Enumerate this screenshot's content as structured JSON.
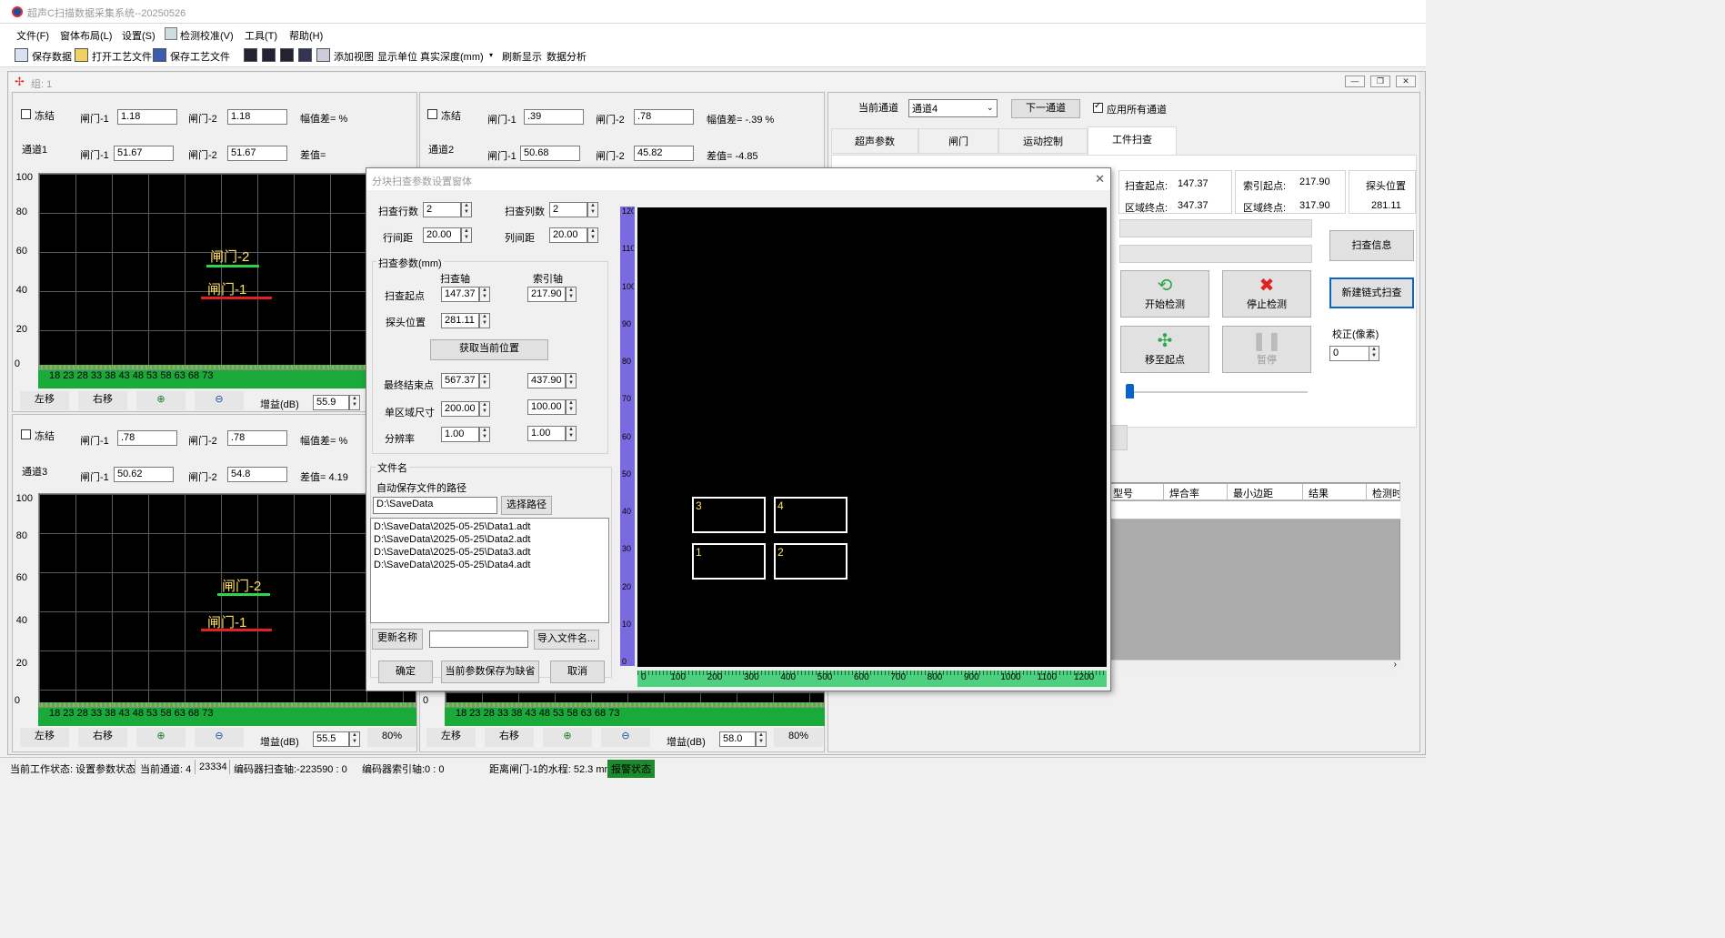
{
  "window": {
    "title": "超声C扫描数据采集系统--20250526"
  },
  "menu": [
    "文件(F)",
    "窗体布局(L)",
    "设置(S)",
    "检测校准(V)",
    "工具(T)",
    "帮助(H)"
  ],
  "toolbar": {
    "save_data": "保存数据",
    "open_process": "打开工艺文件",
    "save_process": "保存工艺文件",
    "add_view": "添加视图",
    "show_unit": "显示单位",
    "depth_mode": "真实深度(mm)",
    "refresh": "刷新显示",
    "analysis": "数据分析"
  },
  "mdi": {
    "title": "组: 1"
  },
  "ch1": {
    "freeze": "冻结",
    "name": "通道1",
    "gate1_lbl": "闸门-1",
    "gate2_lbl": "闸门-2",
    "g1a": "1.18",
    "g2a": "1.18",
    "amp_diff": "幅值差=  %",
    "g1b": "51.67",
    "g2b": "51.67",
    "diff": "差值="
  },
  "ch2": {
    "freeze": "冻结",
    "name": "通道2",
    "gate1_lbl": "闸门-1",
    "gate2_lbl": "闸门-2",
    "g1a": ".39",
    "g2a": ".78",
    "amp_diff": "幅值差= -.39 %",
    "g1b": "50.68",
    "g2b": "45.82",
    "diff": "差值= -4.85"
  },
  "ch3": {
    "freeze": "冻结",
    "name": "通道3",
    "gate1_lbl": "闸门-1",
    "gate2_lbl": "闸门-2",
    "g1a": ".78",
    "g2a": ".78",
    "amp_diff": "幅值差=  %",
    "g1b": "50.62",
    "g2b": "54.8",
    "diff": "差值= 4.19"
  },
  "scope": {
    "yticks": [
      "100",
      "80",
      "60",
      "40",
      "20",
      "0"
    ],
    "xticks": "18  23  28  33  38  43  48  53  58  63  68  73",
    "gate1": "闸门-1",
    "gate2": "闸门-2"
  },
  "scopebtns": {
    "left": "左移",
    "right": "右移",
    "gain": "增益(dB)",
    "gain1": "55.9",
    "gain3": "55.5",
    "gain4": "58.0",
    "pct3": "80%",
    "pct4": "80%",
    "zero": "0"
  },
  "right": {
    "cur_ch_lbl": "当前通道",
    "cur_ch": "通道4",
    "next": "下一通道",
    "apply_all": "应用所有通道",
    "tabs": [
      "超声参数",
      "闸门",
      "运动控制",
      "工件扫查"
    ],
    "scan_start_lbl": "扫查起点:",
    "scan_start": "147.37",
    "area_end_lbl": "区域终点:",
    "area_end": "347.37",
    "idx_start_lbl": "索引起点:",
    "idx_start": "217.90",
    "idx_end_lbl": "区域终点:",
    "idx_end": "317.90",
    "probe_pos_lbl": "探头位置",
    "probe_pos": "281.11",
    "scan_info": "扫查信息",
    "new_chain": "新建链式扫查",
    "start": "开始检测",
    "stop": "停止检测",
    "to_origin": "移至起点",
    "pause": "暂停",
    "correct_lbl": "校正(像素)",
    "correct": "0",
    "table_headers": [
      "型号",
      "焊合率",
      "最小边距",
      "结果",
      "检测时"
    ]
  },
  "dialog": {
    "title": "分块扫查参数设置窗体",
    "rows_lbl": "扫查行数",
    "rows": "2",
    "cols_lbl": "扫查列数",
    "cols": "2",
    "row_gap_lbl": "行间距",
    "row_gap": "20.00",
    "col_gap_lbl": "列间距",
    "col_gap": "20.00",
    "params_lbl": "扫查参数(mm)",
    "scan_axis": "扫查轴",
    "index_axis": "索引轴",
    "start_lbl": "扫查起点",
    "start_s": "147.37",
    "start_i": "217.90",
    "probe_lbl": "探头位置",
    "probe": "281.11",
    "get_pos": "获取当前位置",
    "end_lbl": "最终结束点",
    "end_s": "567.37",
    "end_i": "437.90",
    "size_lbl": "单区域尺寸",
    "size_s": "200.00",
    "size_i": "100.00",
    "res_lbl": "分辨率",
    "res_s": "1.00",
    "res_i": "1.00",
    "file_lbl": "文件名",
    "path_lbl": "自动保存文件的路径",
    "path": "D:\\SaveData",
    "choose": "选择路径",
    "files": [
      "D:\\SaveData\\2025-05-25\\Data1.adt",
      "D:\\SaveData\\2025-05-25\\Data2.adt",
      "D:\\SaveData\\2025-05-25\\Data3.adt",
      "D:\\SaveData\\2025-05-25\\Data4.adt"
    ],
    "rename": "更新名称",
    "import": "导入文件名...",
    "ok": "确定",
    "save_default": "当前参数保存为缺省",
    "cancel": "取消",
    "yticks": [
      "120",
      "110",
      "100",
      "90",
      "80",
      "70",
      "60",
      "50",
      "40",
      "30",
      "20",
      "10",
      "0"
    ],
    "xticks": [
      "0",
      "100",
      "200",
      "300",
      "400",
      "500",
      "600",
      "700",
      "800",
      "900",
      "1000",
      "1100",
      "1200"
    ],
    "blocks": [
      "3",
      "4",
      "1",
      "2"
    ]
  },
  "status": {
    "work": "当前工作状态: 设置参数状态",
    "channel": "当前通道: 4",
    "count": "23334",
    "enc_scan": "编码器扫查轴:-223590  :  0",
    "enc_idx": "编码器索引轴:0   :  0",
    "dist": "距离闸门-1的水程: 52.3 mm",
    "alarm": "报警状态",
    "alarm_color": "#1e8a2e"
  }
}
